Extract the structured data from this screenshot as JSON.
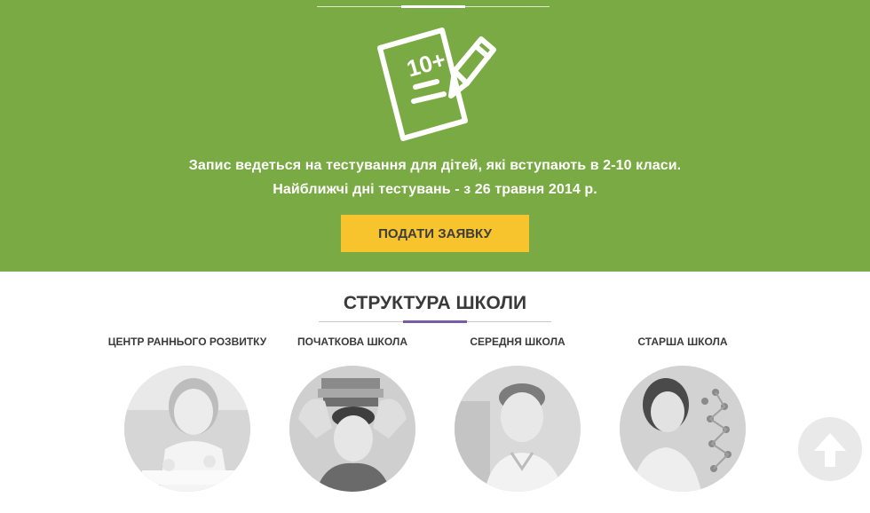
{
  "hero": {
    "illustration_icon": "test-paper-pencil-icon",
    "illustration_grade": "10+",
    "line_1": "Запис ведеться на тестування для дітей, які вступають в 2-10 класи.",
    "line_2": "Найближчі дні тестувань - з 26 травня 2014 р.",
    "apply_button_label": "ПОДАТИ ЗАЯВКУ",
    "background_color": "#7aaa43",
    "button_color": "#f8c42d"
  },
  "structure": {
    "title": "СТРУКТУРА ШКОЛИ",
    "accent_color": "#7a5ba8",
    "cards": [
      {
        "label": "ЦЕНТР РАННЬОГО РОЗВИТКУ",
        "photo": "child-drawing-photo"
      },
      {
        "label": "ПОЧАТКОВА ШКОЛА",
        "photo": "boy-with-books-photo"
      },
      {
        "label": "СЕРЕДНЯ ШКОЛА",
        "photo": "smiling-boy-photo"
      },
      {
        "label": "СТАРША ШКОЛА",
        "photo": "girl-with-molecule-model-photo"
      }
    ]
  },
  "scroll_top": {
    "icon": "arrow-up-icon"
  }
}
